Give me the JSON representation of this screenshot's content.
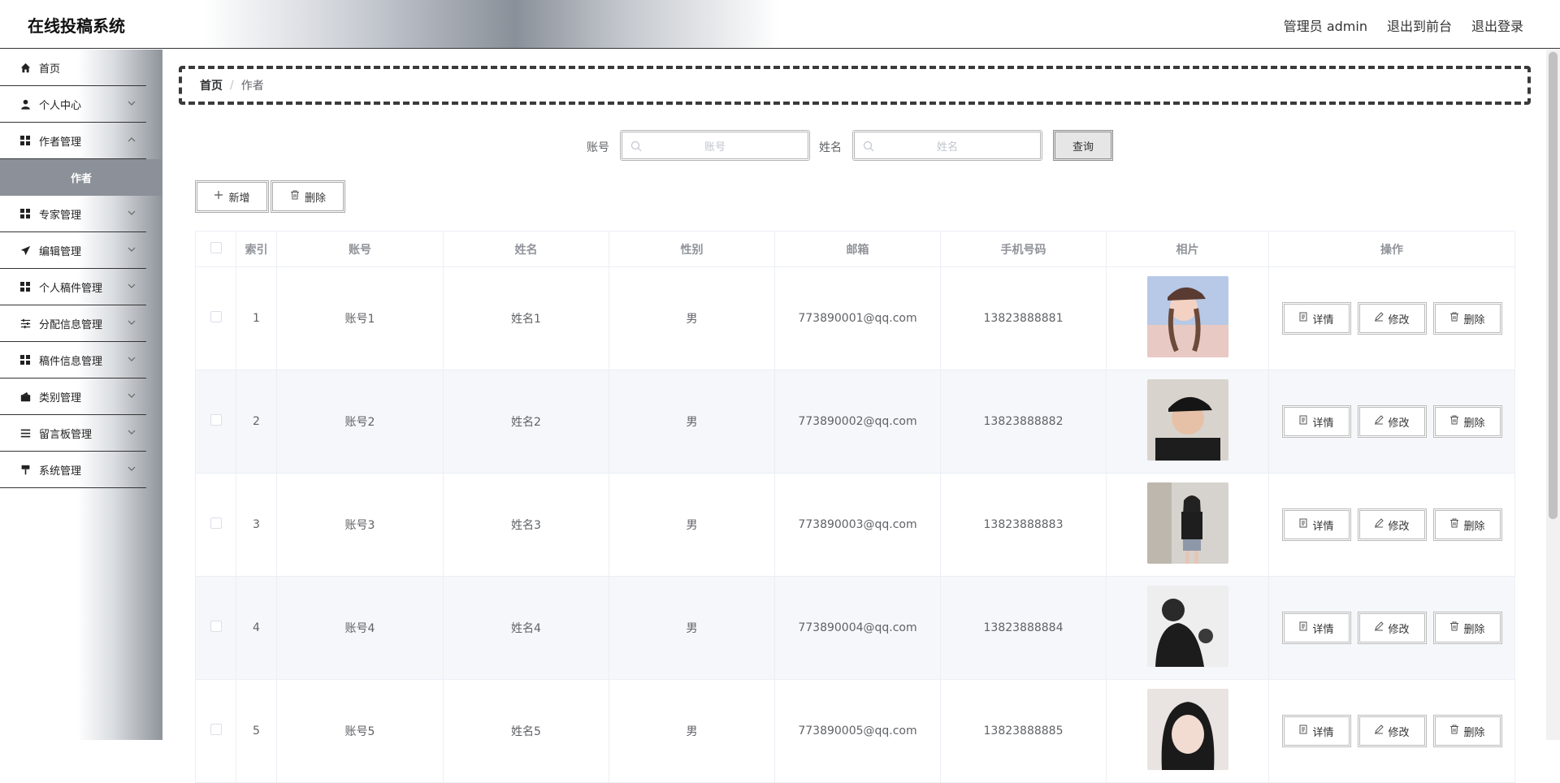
{
  "header": {
    "title": "在线投稿系统",
    "user": "管理员 admin",
    "exit_front": "退出到前台",
    "logout": "退出登录"
  },
  "sidebar": {
    "items": [
      {
        "label": "首页",
        "icon": "home-icon"
      },
      {
        "label": "个人中心",
        "icon": "user-icon"
      },
      {
        "label": "作者管理",
        "icon": "grid-icon"
      },
      {
        "label": "专家管理",
        "icon": "grid-icon"
      },
      {
        "label": "编辑管理",
        "icon": "send-icon"
      },
      {
        "label": "个人稿件管理",
        "icon": "grid-icon"
      },
      {
        "label": "分配信息管理",
        "icon": "sliders-icon"
      },
      {
        "label": "稿件信息管理",
        "icon": "grid-icon"
      },
      {
        "label": "类别管理",
        "icon": "wallet-icon"
      },
      {
        "label": "留言板管理",
        "icon": "list-icon"
      },
      {
        "label": "系统管理",
        "icon": "paint-roller-icon"
      }
    ],
    "active_sub": "作者"
  },
  "breadcrumb": {
    "home": "首页",
    "separator": "/",
    "current": "作者"
  },
  "search": {
    "account_label": "账号",
    "account_placeholder": "账号",
    "name_label": "姓名",
    "name_placeholder": "姓名",
    "query_button": "查询"
  },
  "actions": {
    "add": "新增",
    "delete": "删除"
  },
  "table": {
    "headers": [
      "索引",
      "账号",
      "姓名",
      "性别",
      "邮箱",
      "手机号码",
      "相片",
      "操作"
    ],
    "rows": [
      {
        "index": "1",
        "account": "账号1",
        "name": "姓名1",
        "gender": "男",
        "email": "773890001@qq.com",
        "phone": "13823888881",
        "photo_desc": "girl-cap-photo"
      },
      {
        "index": "2",
        "account": "账号2",
        "name": "姓名2",
        "gender": "男",
        "email": "773890002@qq.com",
        "phone": "13823888882",
        "photo_desc": "boy-cap-photo"
      },
      {
        "index": "3",
        "account": "账号3",
        "name": "姓名3",
        "gender": "男",
        "email": "773890003@qq.com",
        "phone": "13823888883",
        "photo_desc": "girl-standing-photo"
      },
      {
        "index": "4",
        "account": "账号4",
        "name": "姓名4",
        "gender": "男",
        "email": "773890004@qq.com",
        "phone": "13823888884",
        "photo_desc": "man-bw-photo"
      },
      {
        "index": "5",
        "account": "账号5",
        "name": "姓名5",
        "gender": "男",
        "email": "773890005@qq.com",
        "phone": "13823888885",
        "photo_desc": "girl-portrait-photo"
      }
    ],
    "row_actions": {
      "detail": "详情",
      "edit": "修改",
      "delete": "删除"
    }
  },
  "colors": {
    "active_menu_bg": "#8b9099",
    "stripe_bg": "#f5f7fa",
    "border": "#ebeef5"
  }
}
